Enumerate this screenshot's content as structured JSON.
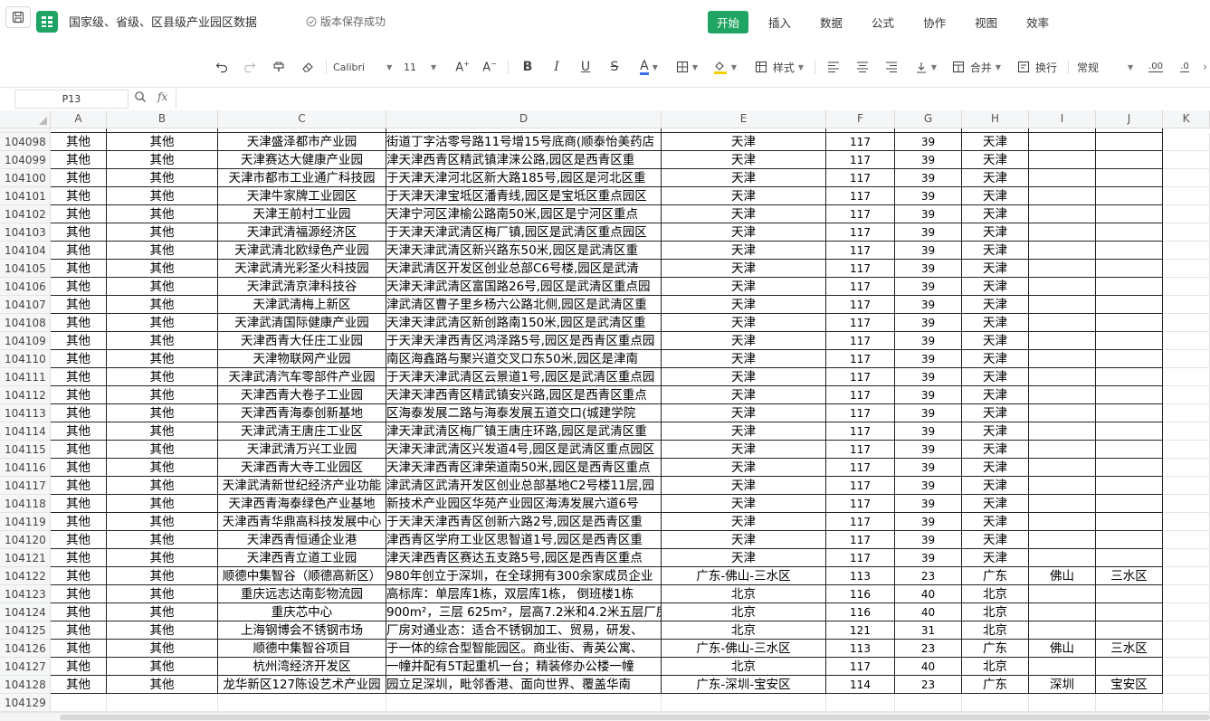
{
  "title": {
    "doc_title": "国家级、省级、区县级产业园区数据",
    "save_status": "版本保存成功"
  },
  "menu": [
    {
      "label": "开始",
      "active": true
    },
    {
      "label": "插入",
      "active": false
    },
    {
      "label": "数据",
      "active": false
    },
    {
      "label": "公式",
      "active": false
    },
    {
      "label": "协作",
      "active": false
    },
    {
      "label": "视图",
      "active": false
    },
    {
      "label": "效率",
      "active": false
    }
  ],
  "toolbar": {
    "font_name": "Calibri",
    "font_size": "11",
    "style_label": "样式",
    "merge_label": "合并",
    "wrap_label": "换行",
    "number_format": "常规"
  },
  "formula": {
    "cell_ref": "P13",
    "fx_label": "fx",
    "content": ""
  },
  "columns": [
    "A",
    "B",
    "C",
    "D",
    "E",
    "F",
    "G",
    "H",
    "I",
    "J",
    "K"
  ],
  "rows": [
    {
      "n": "104098",
      "cells": [
        "其他",
        "其他",
        "天津盛泽都市产业园",
        "街道丁字沽零号路11号增15号底商(顺泰怡美药店",
        "天津",
        "117",
        "39",
        "天津",
        "",
        ""
      ]
    },
    {
      "n": "104099",
      "cells": [
        "其他",
        "其他",
        "天津赛达大健康产业园",
        "津天津西青区精武镇津涞公路,园区是西青区重",
        "天津",
        "117",
        "39",
        "天津",
        "",
        ""
      ]
    },
    {
      "n": "104100",
      "cells": [
        "其他",
        "其他",
        "天津市都市工业通广科技园",
        "于天津天津河北区新大路185号,园区是河北区重",
        "天津",
        "117",
        "39",
        "天津",
        "",
        ""
      ]
    },
    {
      "n": "104101",
      "cells": [
        "其他",
        "其他",
        "天津牛家牌工业园区",
        "于天津天津宝坻区潘青线,园区是宝坻区重点园区",
        "天津",
        "117",
        "39",
        "天津",
        "",
        ""
      ]
    },
    {
      "n": "104102",
      "cells": [
        "其他",
        "其他",
        "天津王前村工业园",
        "天津宁河区津榆公路南50米,园区是宁河区重点",
        "天津",
        "117",
        "39",
        "天津",
        "",
        ""
      ]
    },
    {
      "n": "104103",
      "cells": [
        "其他",
        "其他",
        "天津武清福源经济区",
        "于天津天津武清区梅厂镇,园区是武清区重点园区",
        "天津",
        "117",
        "39",
        "天津",
        "",
        ""
      ]
    },
    {
      "n": "104104",
      "cells": [
        "其他",
        "其他",
        "天津武清北欧绿色产业园",
        "天津天津武清区新兴路东50米,园区是武清区重",
        "天津",
        "117",
        "39",
        "天津",
        "",
        ""
      ]
    },
    {
      "n": "104105",
      "cells": [
        "其他",
        "其他",
        "天津武清光彩圣火科技园",
        "天津武清区开发区创业总部C6号楼,园区是武清",
        "天津",
        "117",
        "39",
        "天津",
        "",
        ""
      ]
    },
    {
      "n": "104106",
      "cells": [
        "其他",
        "其他",
        "天津武清京津科技谷",
        "天津天津武清区富国路26号,园区是武清区重点园",
        "天津",
        "117",
        "39",
        "天津",
        "",
        ""
      ]
    },
    {
      "n": "104107",
      "cells": [
        "其他",
        "其他",
        "天津武清梅上新区",
        "津武清区曹子里乡杨六公路北侧,园区是武清区重",
        "天津",
        "117",
        "39",
        "天津",
        "",
        ""
      ]
    },
    {
      "n": "104108",
      "cells": [
        "其他",
        "其他",
        "天津武清国际健康产业园",
        "天津天津武清区新创路南150米,园区是武清区重",
        "天津",
        "117",
        "39",
        "天津",
        "",
        ""
      ]
    },
    {
      "n": "104109",
      "cells": [
        "其他",
        "其他",
        "天津西青大任庄工业园",
        "于天津天津西青区鸿泽路5号,园区是西青区重点园",
        "天津",
        "117",
        "39",
        "天津",
        "",
        ""
      ]
    },
    {
      "n": "104110",
      "cells": [
        "其他",
        "其他",
        "天津物联网产业园",
        "南区海鑫路与聚兴道交叉口东50米,园区是津南",
        "天津",
        "117",
        "39",
        "天津",
        "",
        ""
      ]
    },
    {
      "n": "104111",
      "cells": [
        "其他",
        "其他",
        "天津武清汽车零部件产业园",
        "于天津天津武清区云景道1号,园区是武清区重点园",
        "天津",
        "117",
        "39",
        "天津",
        "",
        ""
      ]
    },
    {
      "n": "104112",
      "cells": [
        "其他",
        "其他",
        "天津西青大卷子工业园",
        "天津天津西青区精武镇安兴路,园区是西青区重点",
        "天津",
        "117",
        "39",
        "天津",
        "",
        ""
      ]
    },
    {
      "n": "104113",
      "cells": [
        "其他",
        "其他",
        "天津西青海泰创新基地",
        "区海泰发展二路与海泰发展五道交口(城建学院",
        "天津",
        "117",
        "39",
        "天津",
        "",
        ""
      ]
    },
    {
      "n": "104114",
      "cells": [
        "其他",
        "其他",
        "天津武清王唐庄工业区",
        "津天津武清区梅厂镇王唐庄环路,园区是武清区重",
        "天津",
        "117",
        "39",
        "天津",
        "",
        ""
      ]
    },
    {
      "n": "104115",
      "cells": [
        "其他",
        "其他",
        "天津武清万兴工业园",
        "天津天津武清区兴发道4号,园区是武清区重点园区",
        "天津",
        "117",
        "39",
        "天津",
        "",
        ""
      ]
    },
    {
      "n": "104116",
      "cells": [
        "其他",
        "其他",
        "天津西青大寺工业园区",
        "天津天津西青区津荣道南50米,园区是西青区重点",
        "天津",
        "117",
        "39",
        "天津",
        "",
        ""
      ]
    },
    {
      "n": "104117",
      "cells": [
        "其他",
        "其他",
        "天津武清新世纪经济产业功能",
        "津武清区武清开发区创业总部基地C2号楼11层,园",
        "天津",
        "117",
        "39",
        "天津",
        "",
        ""
      ]
    },
    {
      "n": "104118",
      "cells": [
        "其他",
        "其他",
        "天津西青海泰绿色产业基地",
        "新技术产业园区华苑产业园区海涛发展六道6号",
        "天津",
        "117",
        "39",
        "天津",
        "",
        ""
      ]
    },
    {
      "n": "104119",
      "cells": [
        "其他",
        "其他",
        "天津西青华鼎高科技发展中心",
        "于天津天津西青区创新六路2号,园区是西青区重",
        "天津",
        "117",
        "39",
        "天津",
        "",
        ""
      ]
    },
    {
      "n": "104120",
      "cells": [
        "其他",
        "其他",
        "天津西青恒通企业港",
        "津西青区学府工业区思智道1号,园区是西青区重",
        "天津",
        "117",
        "39",
        "天津",
        "",
        ""
      ]
    },
    {
      "n": "104121",
      "cells": [
        "其他",
        "其他",
        "天津西青立道工业园",
        "津天津西青区赛达五支路5号,园区是西青区重点",
        "天津",
        "117",
        "39",
        "天津",
        "",
        ""
      ]
    },
    {
      "n": "104122",
      "cells": [
        "其他",
        "其他",
        "顺德中集智谷（顺德高新区）",
        "980年创立于深圳，在全球拥有300余家成员企业",
        "广东-佛山-三水区",
        "113",
        "23",
        "广东",
        "佛山",
        "三水区"
      ]
    },
    {
      "n": "104123",
      "cells": [
        "其他",
        "其他",
        "重庆远志达南彭物流园",
        "高标库：单层库1栋，双层库1栋， 倒班楼1栋",
        "北京",
        "116",
        "40",
        "北京",
        "",
        ""
      ]
    },
    {
      "n": "104124",
      "cells": [
        "其他",
        "其他",
        "重庆芯中心",
        "900m²，三层 625m²，层高7.2米和4.2米五层厂房",
        "北京",
        "116",
        "40",
        "北京",
        "",
        ""
      ]
    },
    {
      "n": "104125",
      "cells": [
        "其他",
        "其他",
        "上海钢博会不锈钢市场",
        "厂房对通业态：适合不锈钢加工、贸易，研发、",
        "北京",
        "121",
        "31",
        "北京",
        "",
        ""
      ]
    },
    {
      "n": "104126",
      "cells": [
        "其他",
        "其他",
        "顺德中集智谷项目",
        "于一体的综合型智能园区。商业街、青英公寓、",
        "广东-佛山-三水区",
        "113",
        "23",
        "广东",
        "佛山",
        "三水区"
      ]
    },
    {
      "n": "104127",
      "cells": [
        "其他",
        "其他",
        "杭州湾经济开发区",
        "一幢并配有5T起重机一台；精装修办公楼一幢",
        "北京",
        "117",
        "40",
        "北京",
        "",
        ""
      ]
    },
    {
      "n": "104128",
      "cells": [
        "其他",
        "其他",
        "龙华新区127陈设艺术产业园",
        "园立足深圳，毗邻香港、面向世界、覆盖华南",
        "广东-深圳-宝安区",
        "114",
        "23",
        "广东",
        "深圳",
        "宝安区"
      ]
    },
    {
      "n": "104129",
      "cells": [
        "",
        "",
        "",
        "",
        "",
        "",
        "",
        "",
        "",
        ""
      ]
    }
  ]
}
